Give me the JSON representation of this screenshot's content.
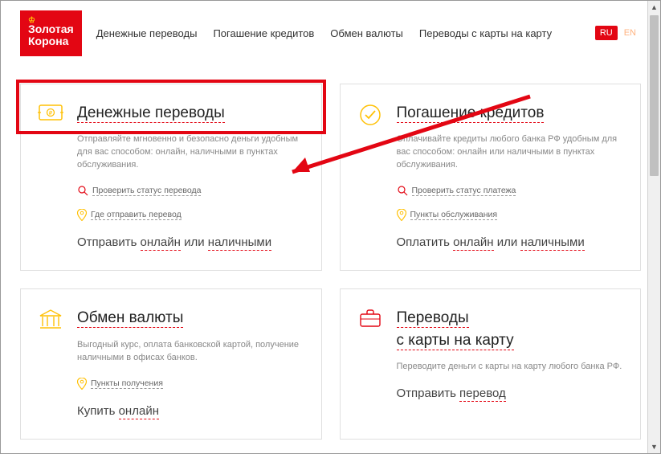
{
  "logo": {
    "line1": "Золотая",
    "line2": "Корона"
  },
  "nav": {
    "items": [
      "Денежные переводы",
      "Погашение кредитов",
      "Обмен валюты",
      "Переводы с карты на карту"
    ]
  },
  "lang": {
    "ru": "RU",
    "en": "EN"
  },
  "cards": {
    "transfers": {
      "title": "Денежные переводы",
      "desc": "Отправляйте мгновенно и безопасно деньги удобным для вас способом: онлайн, наличными в пунктах обслуживания.",
      "link1": "Проверить статус перевода",
      "link2": "Где отправить перевод",
      "action_prefix": "Отправить ",
      "action_u1": "онлайн",
      "action_mid": " или ",
      "action_u2": "наличными"
    },
    "credits": {
      "title": "Погашение кредитов",
      "desc": "Оплачивайте кредиты любого банка РФ удобным для вас способом: онлайн или наличными в пунктах обслуживания.",
      "link1": "Проверить статус платежа",
      "link2": "Пункты обслуживания",
      "action_prefix": "Оплатить ",
      "action_u1": "онлайн",
      "action_mid": " или ",
      "action_u2": "наличными"
    },
    "exchange": {
      "title": "Обмен валюты",
      "desc": "Выгодный курс, оплата банковской картой, получение наличными в офисах банков.",
      "link1": "Пункты получения",
      "action_prefix": "Купить ",
      "action_u1": "онлайн"
    },
    "card2card": {
      "title_line1": "Переводы",
      "title_line2": "с карты на карту",
      "desc": "Переводите деньги с карты на карту любого банка РФ.",
      "action_prefix": "Отправить ",
      "action_u1": "перевод"
    }
  }
}
